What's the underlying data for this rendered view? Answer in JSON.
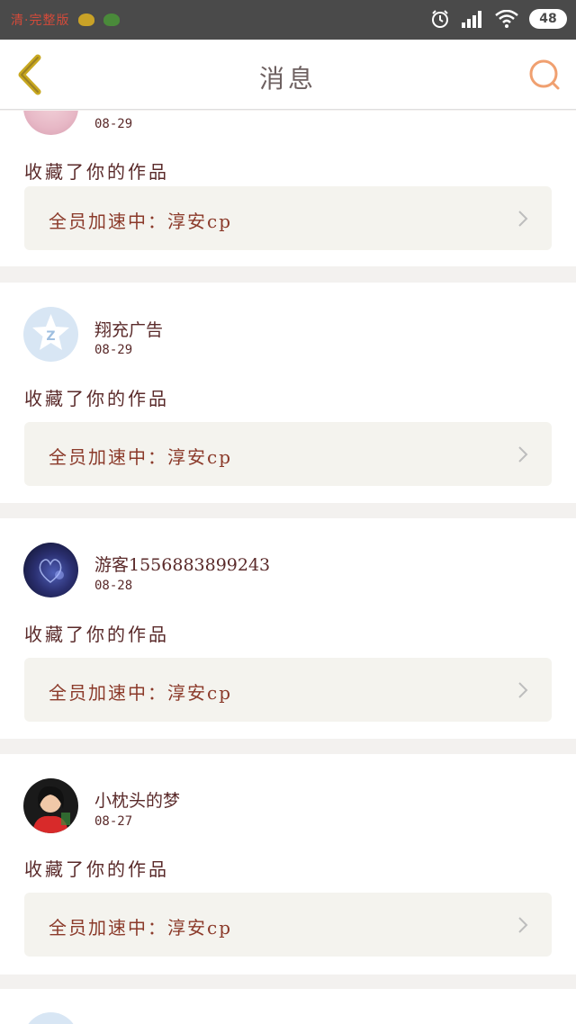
{
  "status_bar": {
    "app_text": "清·完整版",
    "battery": "48"
  },
  "header": {
    "title": "消息"
  },
  "notifications": [
    {
      "username": "",
      "date": "08-29",
      "action": "收藏了你的作品",
      "work_title": "全员加速中：淳安cp"
    },
    {
      "username": "翔充广告",
      "date": "08-29",
      "action": "收藏了你的作品",
      "work_title": "全员加速中：淳安cp"
    },
    {
      "username": "游客1556883899243",
      "date": "08-28",
      "action": "收藏了你的作品",
      "work_title": "全员加速中：淳安cp"
    },
    {
      "username": "小枕头的梦",
      "date": "08-27",
      "action": "收藏了你的作品",
      "work_title": "全员加速中：淳安cp"
    }
  ],
  "colors": {
    "status_bar_bg": "#4a4a4a",
    "accent_orange": "#f0a070",
    "back_arrow": "#c8a820",
    "text_dark_red": "#5a2a2a"
  },
  "icons": {
    "back": "chevron-left-icon",
    "search": "search-icon",
    "chevron": "chevron-right-icon"
  }
}
